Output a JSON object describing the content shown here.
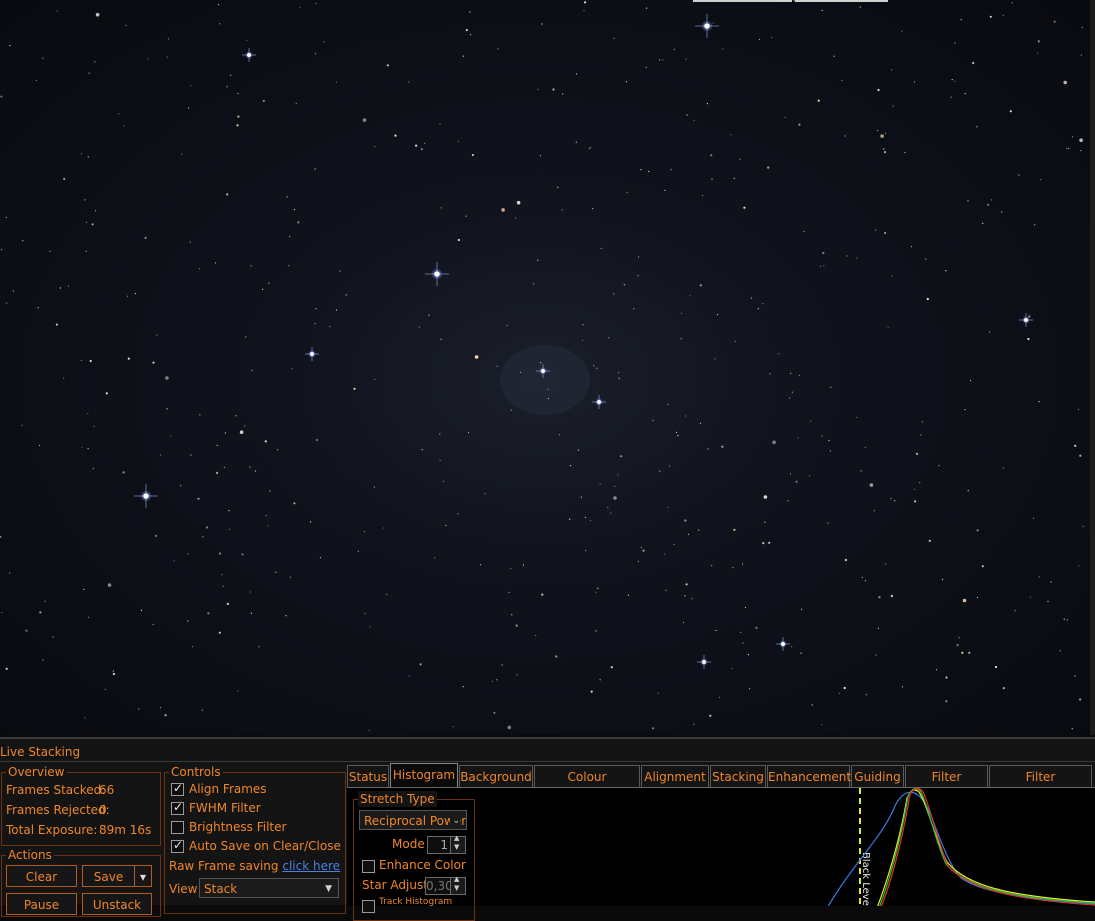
{
  "panel": {
    "title": "Live Stacking"
  },
  "overview": {
    "legend": "Overview",
    "frames_stacked_label": "Frames Stacked:",
    "frames_stacked_value": "66",
    "frames_rejected_label": "Frames Rejected:",
    "frames_rejected_value": "0",
    "total_exposure_label": "Total Exposure:",
    "total_exposure_value": "89m 16s"
  },
  "actions": {
    "legend": "Actions",
    "clear_label": "Clear",
    "save_label": "Save",
    "pause_label": "Pause",
    "unstack_label": "Unstack"
  },
  "controls": {
    "legend": "Controls",
    "align_frames": {
      "label": "Align Frames",
      "checked": true
    },
    "fwhm_filter": {
      "label": "FWHM Filter",
      "checked": true
    },
    "brightness_filter": {
      "label": "Brightness Filter",
      "checked": false
    },
    "auto_save": {
      "label": "Auto Save on Clear/Close",
      "checked": true
    },
    "raw_frame_label": "Raw Frame saving",
    "raw_frame_link": "click here",
    "view_label": "View",
    "view_value": "Stack"
  },
  "tabs": [
    "Status",
    "Histogram",
    "Background",
    "Colour Calibration",
    "Alignment",
    "Stacking",
    "Enhancement",
    "Guiding",
    "Filter (FWHM)",
    "Filter (Brightness)"
  ],
  "active_tab": "Histogram",
  "histogram": {
    "stretch_legend": "Stretch Type",
    "stretch_value": "Reciprocal Power",
    "mode_label": "Mode",
    "mode_value": "1",
    "enhance_color_label": "Enhance Color",
    "enhance_color_checked": false,
    "star_adjust_label": "Star Adjust",
    "star_adjust_value": "0,30",
    "track_histogram_label": "Track Histogram",
    "black_level_label": "Black Level"
  },
  "colors": {
    "accent": "#f0862a",
    "red": "#e03030",
    "green": "#30c030",
    "blue": "#3a7ae0",
    "yellow": "#e8e830"
  }
}
